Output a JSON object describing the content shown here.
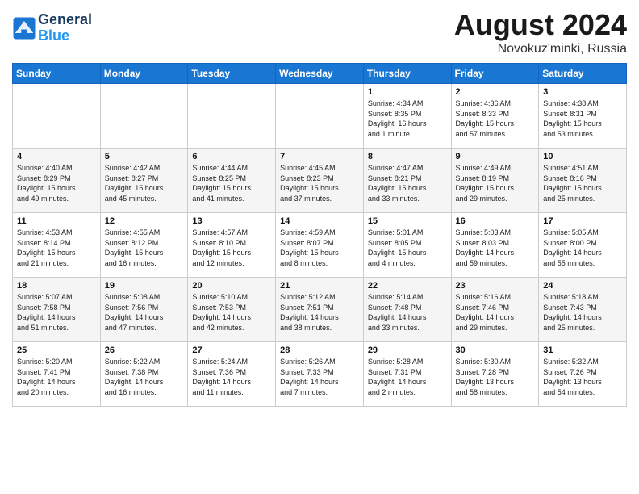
{
  "logo": {
    "line1": "General",
    "line2": "Blue"
  },
  "title": "August 2024",
  "location": "Novokuz'minki, Russia",
  "weekdays": [
    "Sunday",
    "Monday",
    "Tuesday",
    "Wednesday",
    "Thursday",
    "Friday",
    "Saturday"
  ],
  "weeks": [
    [
      {
        "day": "",
        "info": ""
      },
      {
        "day": "",
        "info": ""
      },
      {
        "day": "",
        "info": ""
      },
      {
        "day": "",
        "info": ""
      },
      {
        "day": "1",
        "info": "Sunrise: 4:34 AM\nSunset: 8:35 PM\nDaylight: 16 hours\nand 1 minute."
      },
      {
        "day": "2",
        "info": "Sunrise: 4:36 AM\nSunset: 8:33 PM\nDaylight: 15 hours\nand 57 minutes."
      },
      {
        "day": "3",
        "info": "Sunrise: 4:38 AM\nSunset: 8:31 PM\nDaylight: 15 hours\nand 53 minutes."
      }
    ],
    [
      {
        "day": "4",
        "info": "Sunrise: 4:40 AM\nSunset: 8:29 PM\nDaylight: 15 hours\nand 49 minutes."
      },
      {
        "day": "5",
        "info": "Sunrise: 4:42 AM\nSunset: 8:27 PM\nDaylight: 15 hours\nand 45 minutes."
      },
      {
        "day": "6",
        "info": "Sunrise: 4:44 AM\nSunset: 8:25 PM\nDaylight: 15 hours\nand 41 minutes."
      },
      {
        "day": "7",
        "info": "Sunrise: 4:45 AM\nSunset: 8:23 PM\nDaylight: 15 hours\nand 37 minutes."
      },
      {
        "day": "8",
        "info": "Sunrise: 4:47 AM\nSunset: 8:21 PM\nDaylight: 15 hours\nand 33 minutes."
      },
      {
        "day": "9",
        "info": "Sunrise: 4:49 AM\nSunset: 8:19 PM\nDaylight: 15 hours\nand 29 minutes."
      },
      {
        "day": "10",
        "info": "Sunrise: 4:51 AM\nSunset: 8:16 PM\nDaylight: 15 hours\nand 25 minutes."
      }
    ],
    [
      {
        "day": "11",
        "info": "Sunrise: 4:53 AM\nSunset: 8:14 PM\nDaylight: 15 hours\nand 21 minutes."
      },
      {
        "day": "12",
        "info": "Sunrise: 4:55 AM\nSunset: 8:12 PM\nDaylight: 15 hours\nand 16 minutes."
      },
      {
        "day": "13",
        "info": "Sunrise: 4:57 AM\nSunset: 8:10 PM\nDaylight: 15 hours\nand 12 minutes."
      },
      {
        "day": "14",
        "info": "Sunrise: 4:59 AM\nSunset: 8:07 PM\nDaylight: 15 hours\nand 8 minutes."
      },
      {
        "day": "15",
        "info": "Sunrise: 5:01 AM\nSunset: 8:05 PM\nDaylight: 15 hours\nand 4 minutes."
      },
      {
        "day": "16",
        "info": "Sunrise: 5:03 AM\nSunset: 8:03 PM\nDaylight: 14 hours\nand 59 minutes."
      },
      {
        "day": "17",
        "info": "Sunrise: 5:05 AM\nSunset: 8:00 PM\nDaylight: 14 hours\nand 55 minutes."
      }
    ],
    [
      {
        "day": "18",
        "info": "Sunrise: 5:07 AM\nSunset: 7:58 PM\nDaylight: 14 hours\nand 51 minutes."
      },
      {
        "day": "19",
        "info": "Sunrise: 5:08 AM\nSunset: 7:56 PM\nDaylight: 14 hours\nand 47 minutes."
      },
      {
        "day": "20",
        "info": "Sunrise: 5:10 AM\nSunset: 7:53 PM\nDaylight: 14 hours\nand 42 minutes."
      },
      {
        "day": "21",
        "info": "Sunrise: 5:12 AM\nSunset: 7:51 PM\nDaylight: 14 hours\nand 38 minutes."
      },
      {
        "day": "22",
        "info": "Sunrise: 5:14 AM\nSunset: 7:48 PM\nDaylight: 14 hours\nand 33 minutes."
      },
      {
        "day": "23",
        "info": "Sunrise: 5:16 AM\nSunset: 7:46 PM\nDaylight: 14 hours\nand 29 minutes."
      },
      {
        "day": "24",
        "info": "Sunrise: 5:18 AM\nSunset: 7:43 PM\nDaylight: 14 hours\nand 25 minutes."
      }
    ],
    [
      {
        "day": "25",
        "info": "Sunrise: 5:20 AM\nSunset: 7:41 PM\nDaylight: 14 hours\nand 20 minutes."
      },
      {
        "day": "26",
        "info": "Sunrise: 5:22 AM\nSunset: 7:38 PM\nDaylight: 14 hours\nand 16 minutes."
      },
      {
        "day": "27",
        "info": "Sunrise: 5:24 AM\nSunset: 7:36 PM\nDaylight: 14 hours\nand 11 minutes."
      },
      {
        "day": "28",
        "info": "Sunrise: 5:26 AM\nSunset: 7:33 PM\nDaylight: 14 hours\nand 7 minutes."
      },
      {
        "day": "29",
        "info": "Sunrise: 5:28 AM\nSunset: 7:31 PM\nDaylight: 14 hours\nand 2 minutes."
      },
      {
        "day": "30",
        "info": "Sunrise: 5:30 AM\nSunset: 7:28 PM\nDaylight: 13 hours\nand 58 minutes."
      },
      {
        "day": "31",
        "info": "Sunrise: 5:32 AM\nSunset: 7:26 PM\nDaylight: 13 hours\nand 54 minutes."
      }
    ]
  ]
}
